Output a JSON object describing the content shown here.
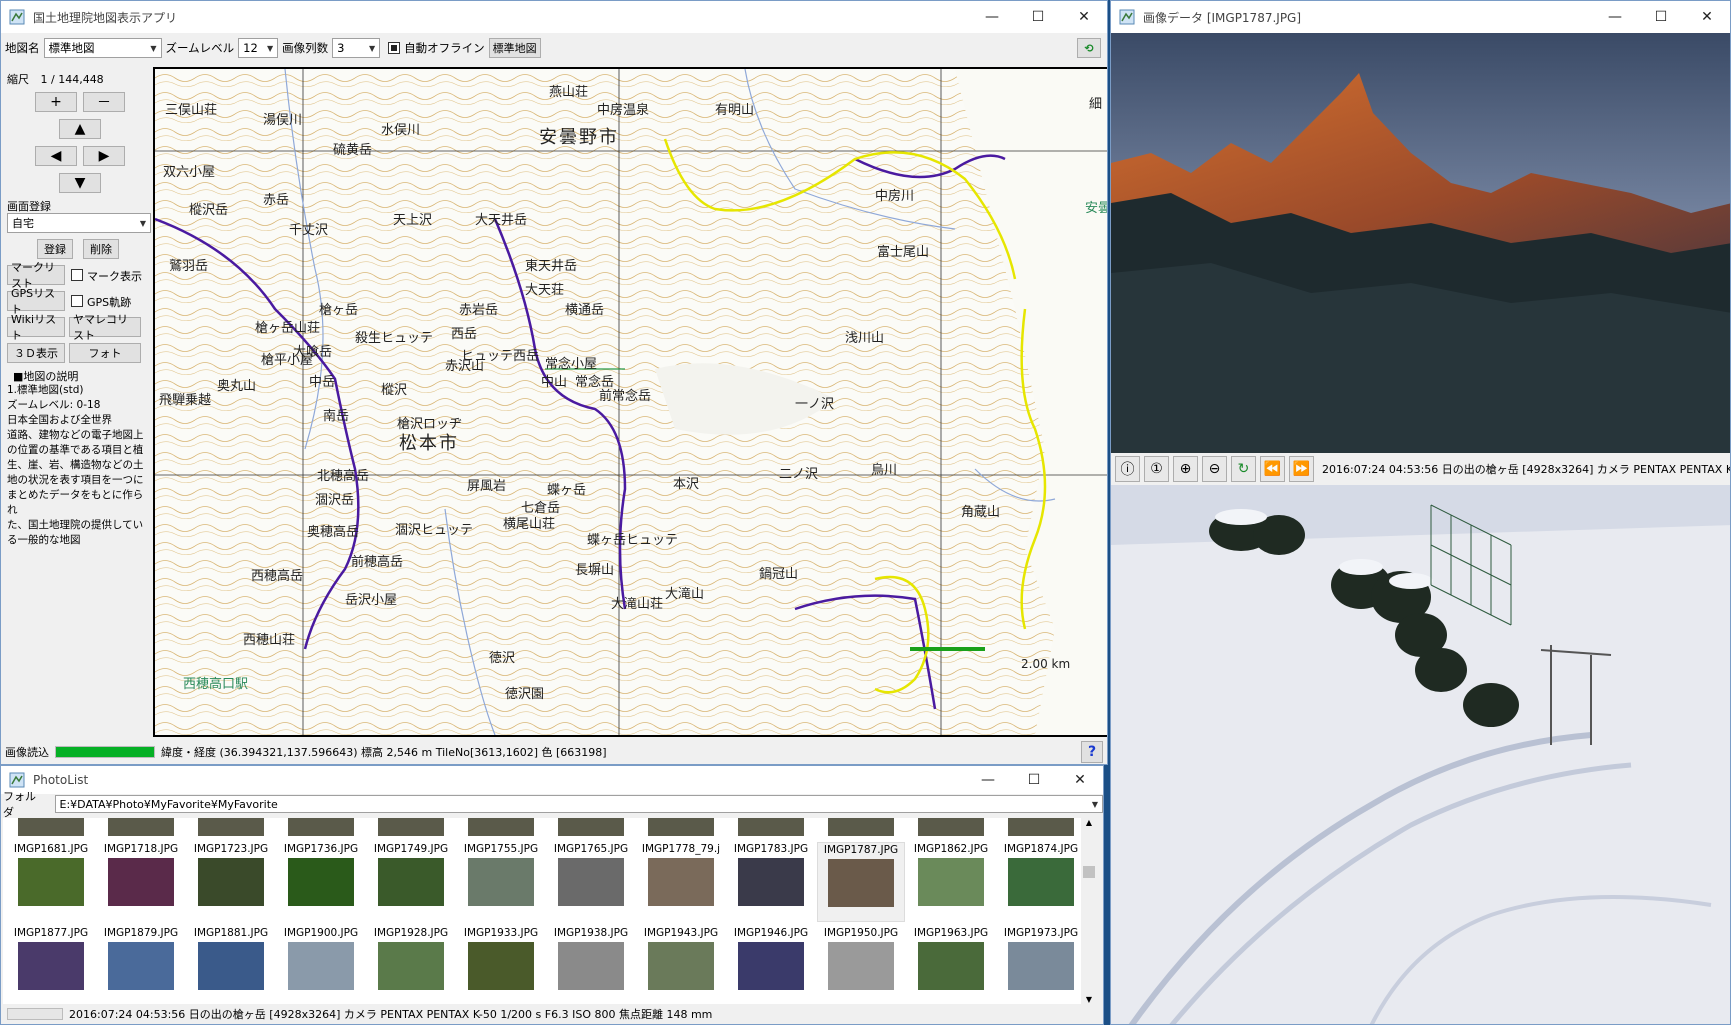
{
  "map_window": {
    "title": "国土地理院地図表示アプリ",
    "toolbar": {
      "mapname_label": "地図名",
      "mapname_value": "標準地図",
      "zoom_label": "ズームレベル",
      "zoom_value": "12",
      "columns_label": "画像列数",
      "columns_value": "3",
      "auto_offline_label": "自動オフライン",
      "std_map_button": "標準地図"
    },
    "left_panel": {
      "scale_label": "縮尺",
      "scale_value": "1 / 144,448",
      "zoom_in": "+",
      "zoom_out": "－",
      "screen_register_label": "画面登録",
      "register_select": "自宅",
      "register_button": "登録",
      "delete_button": "削除",
      "mark_list_button": "マークリスト",
      "mark_show_label": "マーク表示",
      "gps_list_button": "GPSリスト",
      "gps_track_label": "GPS軌跡",
      "wiki_list_button": "Wikiリスト",
      "yamareco_button": "ヤマレコリスト",
      "view3d_button": "３Ｄ表示",
      "photo_button": "フォト",
      "description_title": "■地図の説明",
      "description_lines": [
        "1.標準地図(std)",
        "ズームレベル: 0-18",
        "日本全国および全世界",
        "道路、建物などの電子地図上",
        "の位置の基準である項目と植",
        "生、崖、岩、構造物などの土",
        "地の状況を表す項目を一つに",
        "まとめたデータをもとに作られ",
        "た、国土地理院の提供してい",
        "る一般的な地図"
      ]
    },
    "map_labels": [
      "安曇野市",
      "松本市",
      "燕山荘",
      "中房温泉",
      "有明山",
      "大天井岳",
      "東天井岳",
      "常念岳",
      "常念小屋",
      "前常念岳",
      "横通岳",
      "蝶ヶ岳",
      "蝶ヶ岳ヒュッテ",
      "大滝山",
      "大滝山荘",
      "鍋冠山",
      "徳沢",
      "横尾山荘",
      "長塀山",
      "本沢",
      "烏川",
      "角蔵山",
      "富士尾山",
      "浅川山",
      "中房川",
      "槍ヶ岳",
      "槍ヶ岳山荘",
      "大喰岳",
      "中岳",
      "南岳",
      "北穂高岳",
      "涸沢岳",
      "奥穂高岳",
      "前穂高岳",
      "西穂高岳",
      "西穂山荘",
      "岳沢小屋",
      "涸沢ヒュッテ",
      "屏風岩",
      "槍沢ロッヂ",
      "殺生ヒュッテ",
      "ヒュッテ西岳",
      "西岳",
      "赤沢山",
      "赤岩岳",
      "中山",
      "硫黄岳",
      "三俣山荘",
      "鷲羽岳",
      "双六小屋",
      "赤岳",
      "樅沢岳",
      "飛騨乗越",
      "奥丸山",
      "槍平小屋",
      "西穂高口駅",
      "徳沢園",
      "二ノ沢",
      "一ノ沢",
      "大天荘",
      "七倉岳",
      "樅沢",
      "千丈沢",
      "天上沢",
      "湯俣川",
      "水俣川",
      "細",
      "安曇"
    ],
    "scale_bar_label": "2.00 km",
    "status": {
      "loading_label": "画像読込",
      "progress": 1.0,
      "coords": "緯度・経度 (36.394321,137.596643) 標高 2,546 m TileNo[3613,1602] 色 [663198]"
    },
    "help_icon": "?"
  },
  "image_window": {
    "title": "画像データ [IMGP1787.JPG]",
    "info": "2016:07:24 04:53:56 日の出の槍ヶ岳 [4928x3264] カメラ PENTAX PENTAX K-50",
    "toolbar_icons": [
      "info-icon",
      "one-to-one-icon",
      "zoom-in-icon",
      "zoom-out-icon",
      "rotate-icon",
      "prev-icon",
      "next-icon"
    ]
  },
  "photolist_window": {
    "title": "PhotoList",
    "folder_label": "フォルダ",
    "folder_path": "E:¥DATA¥Photo¥MyFavorite¥MyFavorite",
    "row1": [
      {
        "name": "IMGP1681.JPG",
        "color": "#4a6a2a"
      },
      {
        "name": "IMGP1718.JPG",
        "color": "#5a2a4a"
      },
      {
        "name": "IMGP1723.JPG",
        "color": "#3a4a2a"
      },
      {
        "name": "IMGP1736.JPG",
        "color": "#2a5a1a"
      },
      {
        "name": "IMGP1749.JPG",
        "color": "#3a5a2a"
      },
      {
        "name": "IMGP1755.JPG",
        "color": "#6a7a6a"
      },
      {
        "name": "IMGP1765.JPG",
        "color": "#6a6a6a"
      },
      {
        "name": "IMGP1778_79.j",
        "color": "#7a6a5a"
      },
      {
        "name": "IMGP1783.JPG",
        "color": "#3a3a4a"
      },
      {
        "name": "IMGP1787.JPG",
        "color": "#6a5a4a"
      },
      {
        "name": "IMGP1862.JPG",
        "color": "#6a8a5a"
      },
      {
        "name": "IMGP1874.JPG",
        "color": "#3a6a3a"
      }
    ],
    "row2": [
      {
        "name": "IMGP1877.JPG",
        "color": "#4a3a6a"
      },
      {
        "name": "IMGP1879.JPG",
        "color": "#4a6a9a"
      },
      {
        "name": "IMGP1881.JPG",
        "color": "#3a5a8a"
      },
      {
        "name": "IMGP1900.JPG",
        "color": "#8a9aaa"
      },
      {
        "name": "IMGP1928.JPG",
        "color": "#5a7a4a"
      },
      {
        "name": "IMGP1933.JPG",
        "color": "#4a5a2a"
      },
      {
        "name": "IMGP1938.JPG",
        "color": "#8a8a8a"
      },
      {
        "name": "IMGP1943.JPG",
        "color": "#6a7a5a"
      },
      {
        "name": "IMGP1946.JPG",
        "color": "#3a3a6a"
      },
      {
        "name": "IMGP1950.JPG",
        "color": "#9a9a9a"
      },
      {
        "name": "IMGP1963.JPG",
        "color": "#4a6a3a"
      },
      {
        "name": "IMGP1973.JPG",
        "color": "#7a8a9a"
      }
    ],
    "status_text": "2016:07:24 04:53:56 日の出の槍ヶ岳 [4928x3264] カメラ PENTAX PENTAX K-50  1/200 s F6.3 ISO 800 焦点距離 148 mm"
  }
}
